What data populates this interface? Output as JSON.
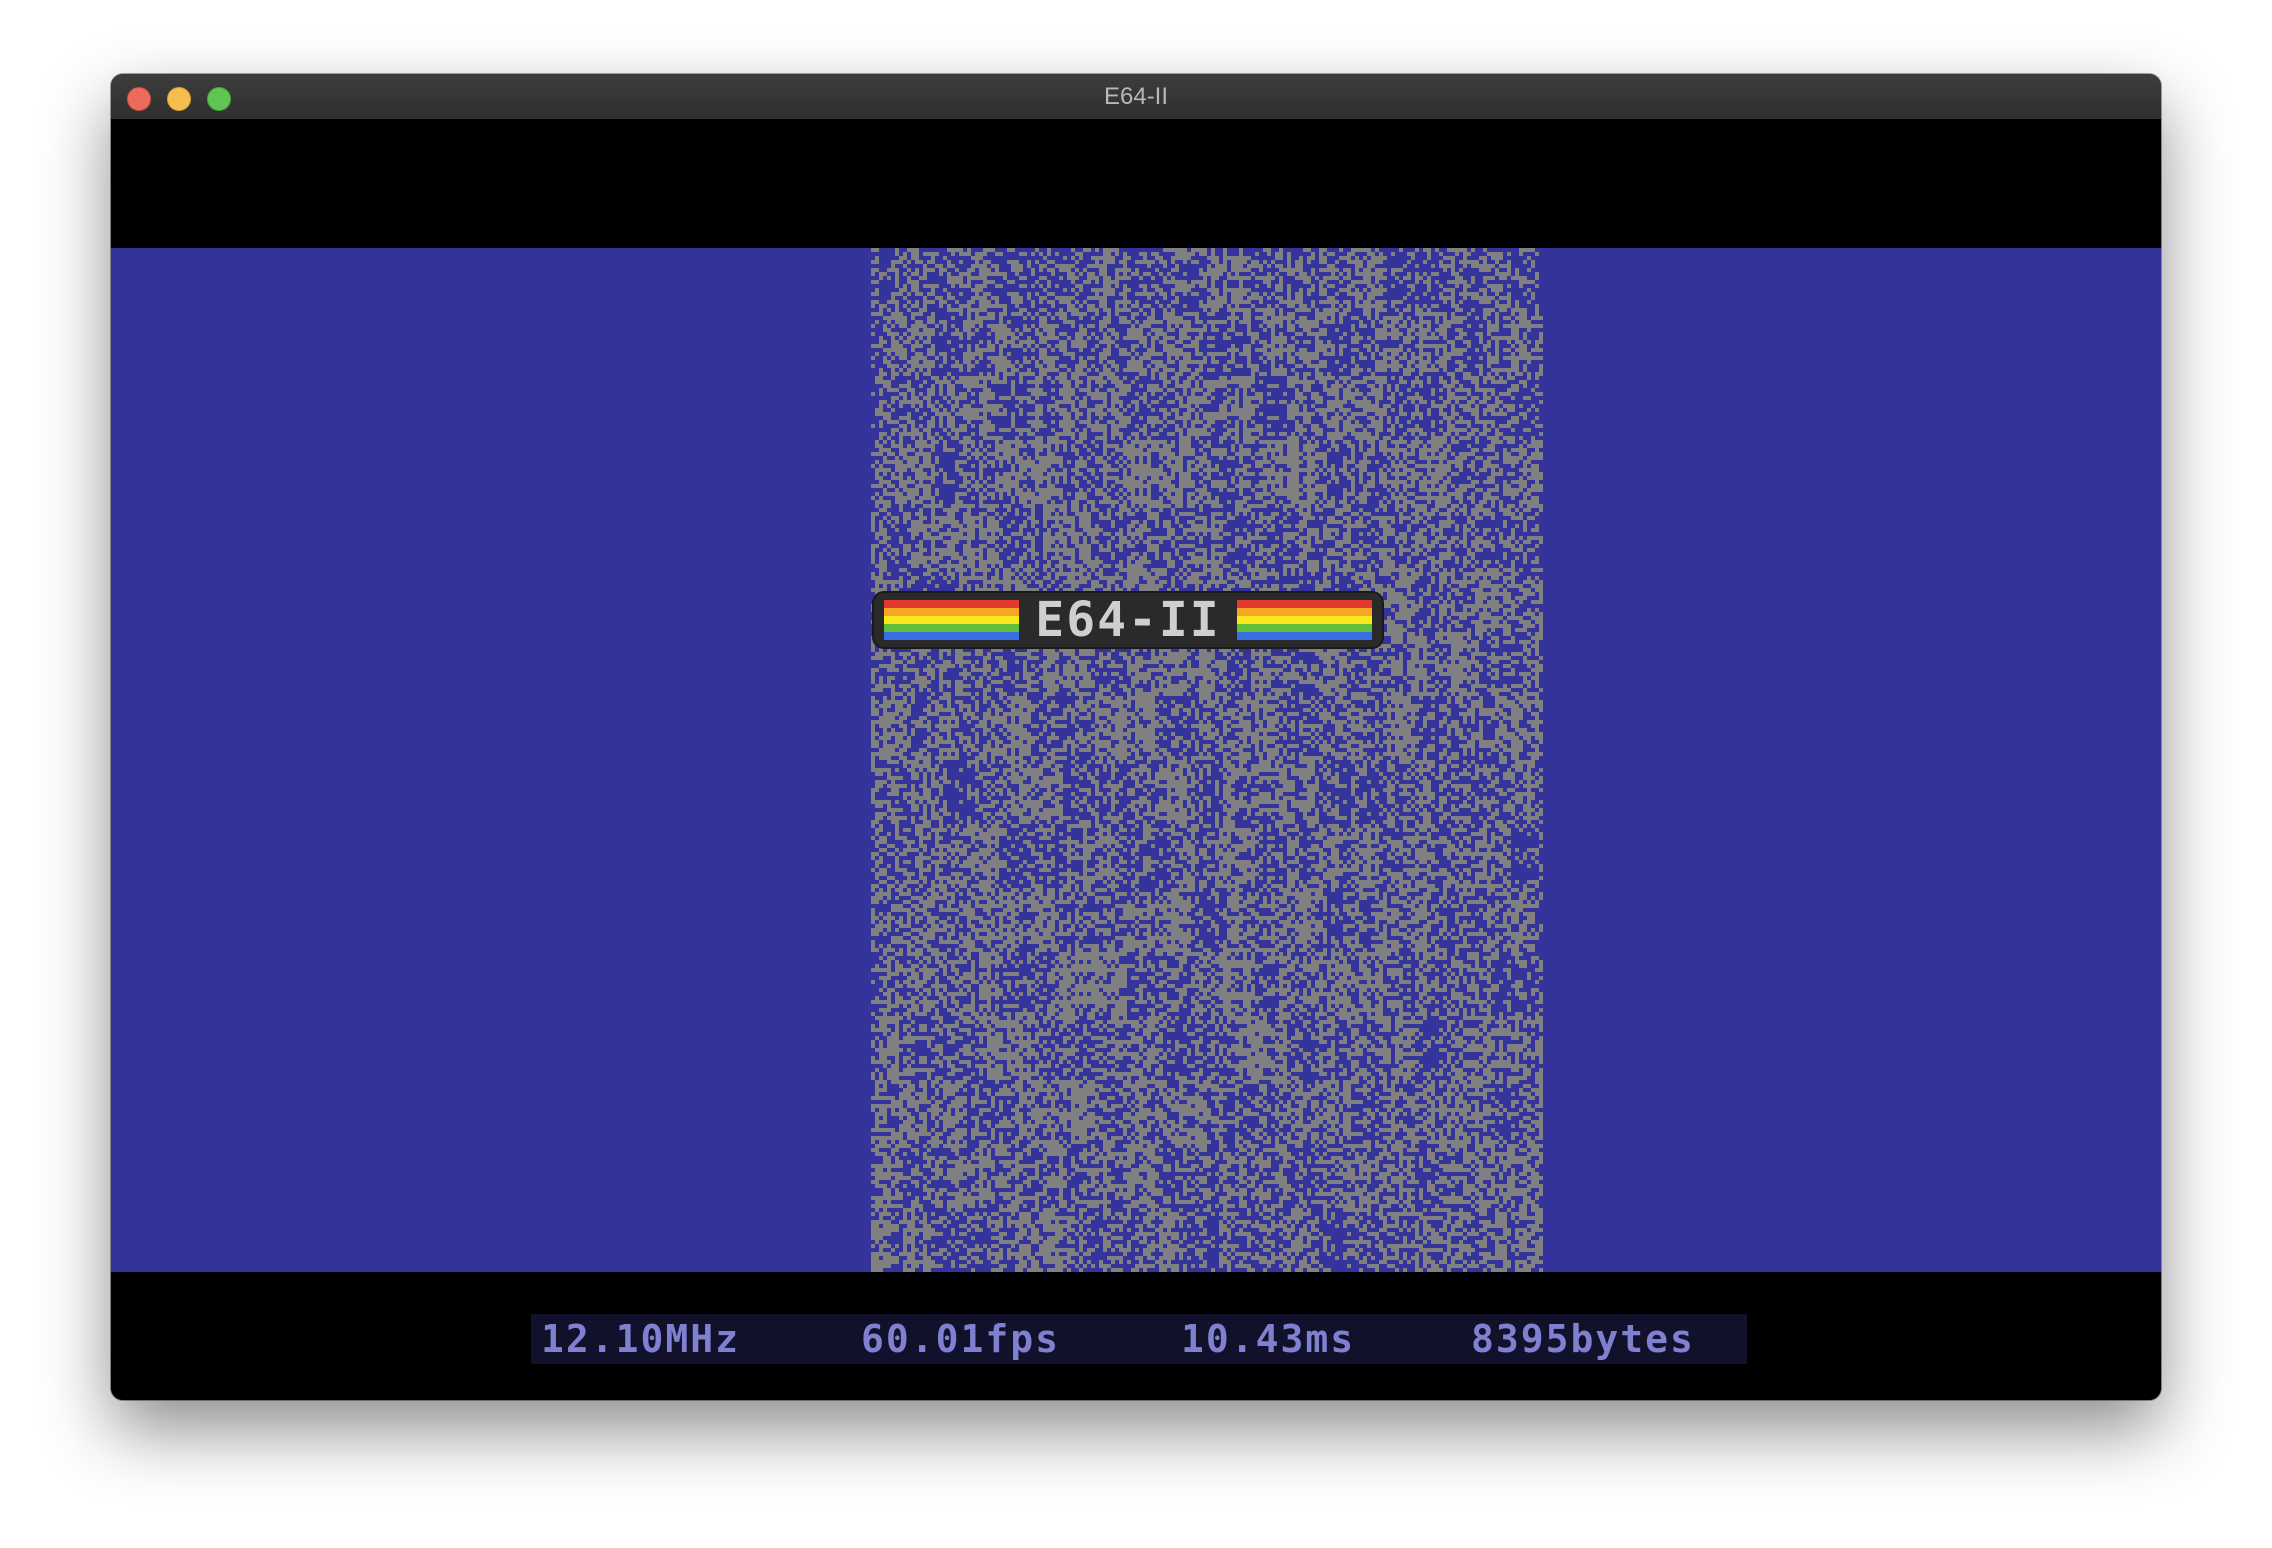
{
  "window": {
    "title": "E64-II"
  },
  "logo": {
    "text": "E64-II",
    "stripe_colors": [
      "#e23a2c",
      "#f6a623",
      "#f8e71c",
      "#5fc13a",
      "#3a6fe2"
    ]
  },
  "colors": {
    "background": "#333399",
    "foreground": "#808080",
    "border": "#000000",
    "status_text": "#8080d0"
  },
  "status_bar": {
    "clock": "12.10MHz",
    "fps": "60.01fps",
    "frame_time": "10.43ms",
    "memory": "8395bytes"
  }
}
